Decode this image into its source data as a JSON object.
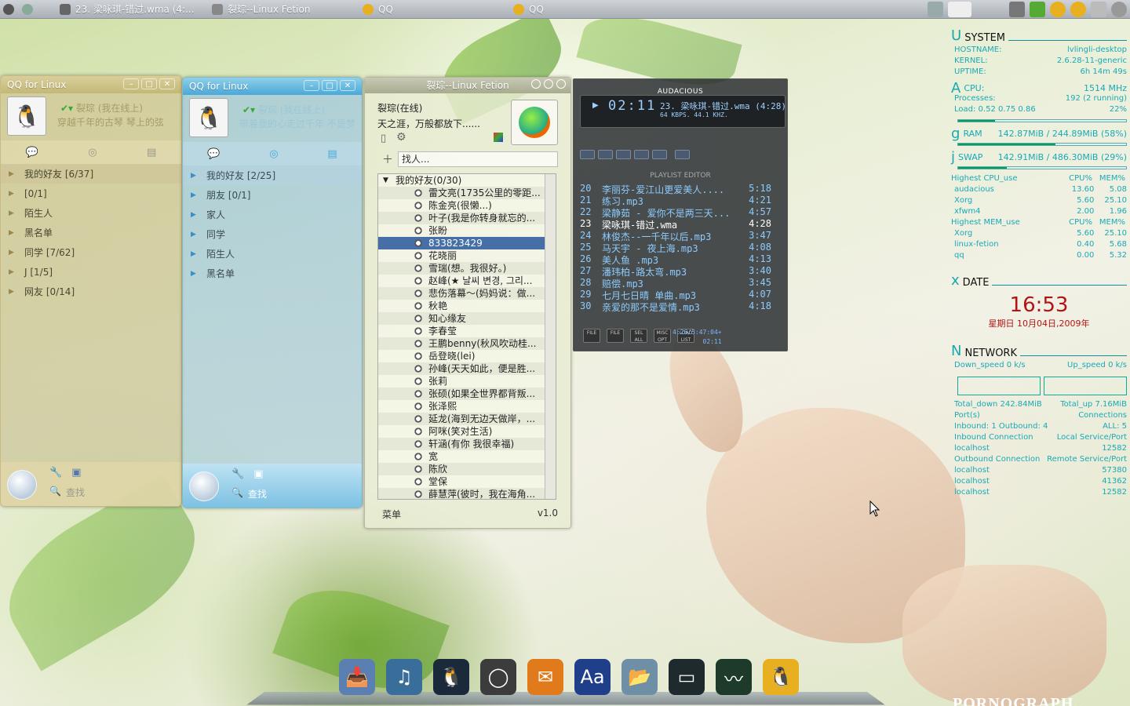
{
  "topbar": {
    "tasks": [
      {
        "label": "23. 梁咏琪-错过.wma (4:..."
      },
      {
        "label": "裂琮--Linux Fetion"
      },
      {
        "label": "QQ"
      },
      {
        "label": "QQ"
      }
    ]
  },
  "qq1": {
    "title": "QQ for Linux",
    "nick": "裂琮 (我在线上)",
    "signature": "穿越千年的古琴 琴上的弦",
    "groups": [
      "我的好友 [6/37]",
      "[0/1]",
      "陌生人",
      "黑名单",
      "同学 [7/62]",
      "J [1/5]",
      "网友 [0/14]"
    ],
    "find": "查找"
  },
  "qq2": {
    "title": "QQ for Linux",
    "nick": "裂琮 (我在线上)",
    "signature": "带着我的心走过千年 不是梦",
    "groups": [
      "我的好友 [2/25]",
      "朋友 [0/1]",
      "家人",
      "同学",
      "陌生人",
      "黑名单"
    ],
    "find": "查找"
  },
  "fetion": {
    "title": "裂琮--Linux Fetion",
    "name": "裂琮(在线)",
    "status": "天之涯，万般都放下......",
    "search_placeholder": "找人...",
    "group": "我的好友(0/30)",
    "contacts": [
      "雷文亮(1735公里的零距...",
      "陈金亮(很懒...)",
      "叶子(我是你转身就忘的...",
      "张盼",
      "833823429",
      "花晓丽",
      "雪瑞(想。我很好。)",
      "赵峰(★ 날씨 변경, 그리...",
      "悲伤落幕～(妈妈说：做...",
      "秋艳",
      "知心缘友",
      "李春莹",
      "王鹏benny(秋风吹动桂...",
      "岳登晓(lei)",
      "孙峰(天天如此，便是胜...",
      "张莉",
      "张硕(如果全世界都背叛...",
      "张泽熙",
      "延龙(海到无边天做岸，...",
      "阿咪(笑对生活)",
      "轩涵(有你 我很幸福)",
      "宽",
      "陈欣",
      "堂保",
      "薛慧萍(彼时，我在海角..."
    ],
    "selected_index": 4,
    "menu": "菜单",
    "version": "v1.0"
  },
  "audacious": {
    "title": "AUDACIOUS",
    "time": "02:11",
    "song": "23. 梁咏琪-错过.wma (4:28)",
    "info": "64 KBPS. 44.1 KHZ.",
    "playlist_title": "PLAYLIST EDITOR",
    "playlist": [
      {
        "n": "20",
        "t": "李丽芬-爱江山更爱美人....",
        "d": "5:18"
      },
      {
        "n": "21",
        "t": "练习.mp3",
        "d": "4:21"
      },
      {
        "n": "22",
        "t": "梁静茹 - 爱你不是两三天...",
        "d": "4:57"
      },
      {
        "n": "23",
        "t": "梁咏琪-错过.wma",
        "d": "4:28"
      },
      {
        "n": "24",
        "t": "林俊杰--一千年以后.mp3",
        "d": "3:47"
      },
      {
        "n": "25",
        "t": "马天宇 - 夜上海.mp3",
        "d": "4:08"
      },
      {
        "n": "26",
        "t": "美人鱼 .mp3",
        "d": "4:13"
      },
      {
        "n": "27",
        "t": "潘玮柏-路太弯.mp3",
        "d": "3:40"
      },
      {
        "n": "28",
        "t": "赔偿.mp3",
        "d": "3:45"
      },
      {
        "n": "29",
        "t": "七月七日晴 单曲.mp3",
        "d": "4:07"
      },
      {
        "n": "30",
        "t": "亲爱的那不是爱情.mp3",
        "d": "4:18"
      }
    ],
    "current_index": 3,
    "pl_buttons": [
      "FILE",
      "FILE",
      "SEL ALL",
      "MISC OPT",
      "LOAD LIST"
    ],
    "pl_status": "4:26/5:47:04+",
    "pl_time": "02:11"
  },
  "conky": {
    "system_head": "SYSTEM",
    "hostname_label": "HOSTNAME:",
    "hostname": "lvlingli-desktop",
    "kernel_label": "KERNEL:",
    "kernel": "2.6.28-11-generic",
    "uptime_label": "UPTIME:",
    "uptime": "6h 14m 49s",
    "cpu_label": "CPU:",
    "cpu": "1514 MHz",
    "proc_label": "Processes:",
    "proc": "192 (2 running)",
    "load_label": "Load: 0.52 0.75 0.86",
    "load_pct": "22%",
    "cpu_fill": 0.22,
    "ram_label": "RAM",
    "ram": "142.87MiB / 244.89MiB (58%)",
    "ram_fill": 0.58,
    "swap_label": "SWAP",
    "swap": "142.91MiB / 486.30MiB (29%)",
    "swap_fill": 0.29,
    "cpu_top_head": [
      "Highest CPU_use",
      "CPU%",
      "MEM%"
    ],
    "cpu_top": [
      [
        "audacious",
        "13.60",
        "5.08"
      ],
      [
        "Xorg",
        "5.60",
        "25.10"
      ],
      [
        "xfwm4",
        "2.00",
        "1.96"
      ]
    ],
    "mem_top_head": [
      "Highest MEM_use",
      "CPU%",
      "MEM%"
    ],
    "mem_top": [
      [
        "Xorg",
        "5.60",
        "25.10"
      ],
      [
        "linux-fetion",
        "0.40",
        "5.68"
      ],
      [
        "qq",
        "0.00",
        "5.32"
      ]
    ],
    "date_head": "DATE",
    "time": "16:53",
    "date": "星期日 10月04日,2009年",
    "net_head": "NETWORK",
    "down_speed": "Down_speed 0 k/s",
    "up_speed": "Up_speed 0 k/s",
    "total_down": "Total_down 242.84MiB",
    "total_up": "Total_up 7.16MiB",
    "ports": "Port(s)",
    "connections": "Connections",
    "inbound": "Inbound: 1  Outbound: 4",
    "all": "ALL: 5",
    "in_conn": "Inbound Connection",
    "local_sp": "Local Service/Port",
    "in_rows": [
      [
        "localhost",
        "12582"
      ]
    ],
    "out_conn": "Outbound Connection",
    "remote_sp": "Remote Service/Port",
    "out_rows": [
      [
        "localhost",
        "57380"
      ],
      [
        "localhost",
        "41362"
      ],
      [
        "localhost",
        "12582"
      ]
    ]
  },
  "dock": {
    "items": [
      "installer-icon",
      "music-player-icon",
      "qq-icon",
      "opera-icon",
      "fetion-icon",
      "dictionary-icon",
      "file-manager-icon",
      "terminal-icon",
      "system-monitor-icon",
      "qq-penguin-icon"
    ]
  },
  "brand": "PORNOGRAPH.."
}
